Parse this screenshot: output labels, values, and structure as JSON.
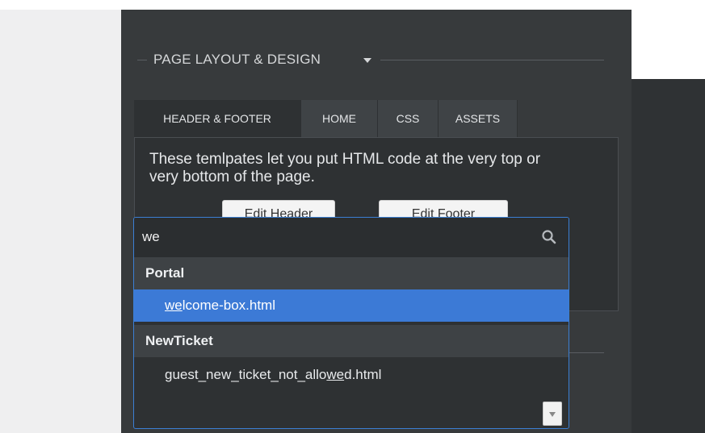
{
  "section": {
    "title": "PAGE LAYOUT & DESIGN"
  },
  "tabs": [
    {
      "label": "HEADER & FOOTER"
    },
    {
      "label": "HOME"
    },
    {
      "label": "CSS"
    },
    {
      "label": "ASSETS"
    }
  ],
  "pane": {
    "description": "These temlpates let you put HTML code at the very top or very bottom of the page.",
    "edit_header_label": "Edit Header",
    "edit_footer_label": "Edit Footer"
  },
  "search": {
    "value": "we"
  },
  "groups": [
    {
      "name": "Portal",
      "options": [
        {
          "before": "",
          "match": "we",
          "after": "lcome-box.html",
          "selected": true
        }
      ]
    },
    {
      "name": "NewTicket",
      "options": [
        {
          "before": "guest_new_ticket_not_allo",
          "match": "we",
          "after": "d.html",
          "selected": false
        }
      ]
    }
  ]
}
